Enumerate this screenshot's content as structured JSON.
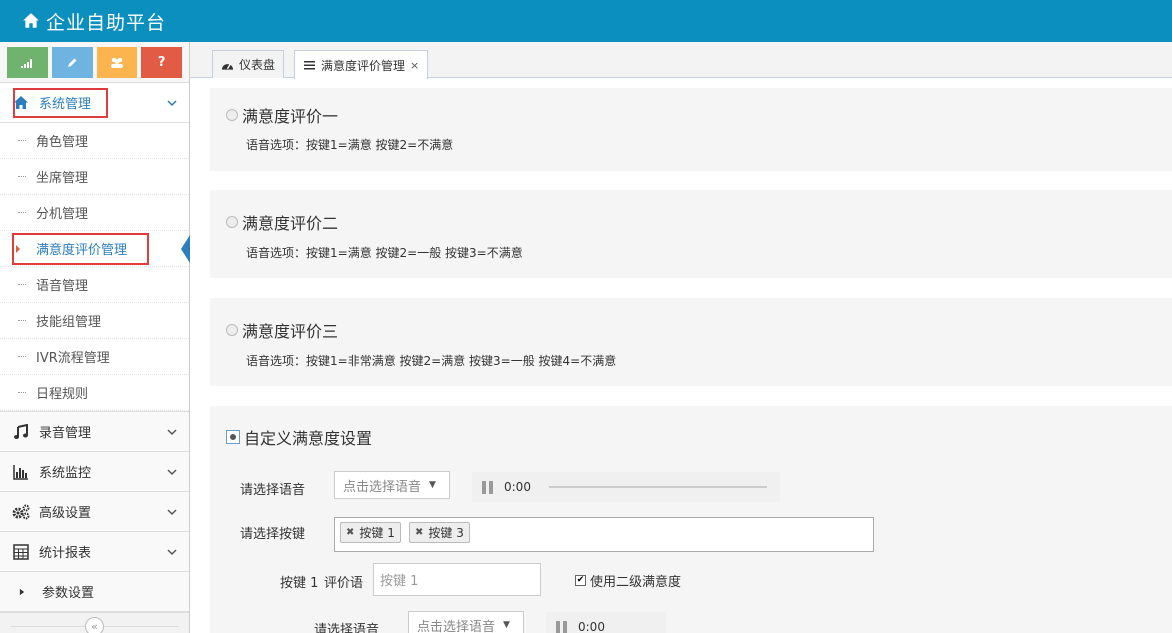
{
  "app": {
    "title": "企业自助平台"
  },
  "shortcuts": [
    {
      "icon": "signal-icon",
      "color": "#6fb36f"
    },
    {
      "icon": "pencil-icon",
      "color": "#6fb3e0"
    },
    {
      "icon": "users-icon",
      "color": "#fcb44f"
    },
    {
      "icon": "question-icon",
      "color": "#e15b45",
      "glyph": "?"
    }
  ],
  "sidebar": {
    "active_group": "系统管理",
    "sub_items": [
      "角色管理",
      "坐席管理",
      "分机管理",
      "满意度评价管理",
      "语音管理",
      "技能组管理",
      "IVR流程管理",
      "日程规则"
    ],
    "active_sub": "满意度评价管理",
    "groups": [
      {
        "label": "录音管理",
        "icon": "music-icon"
      },
      {
        "label": "系统监控",
        "icon": "bar-chart-icon"
      },
      {
        "label": "高级设置",
        "icon": "cogs-icon"
      },
      {
        "label": "统计报表",
        "icon": "calculator-icon"
      },
      {
        "label": "参数设置",
        "icon": "caret-right-icon"
      }
    ],
    "collapse_glyph": "«"
  },
  "tabs": [
    {
      "label": "仪表盘",
      "icon": "dashboard-icon"
    },
    {
      "label": "满意度评价管理",
      "icon": "list-icon",
      "close": "×"
    }
  ],
  "options": [
    {
      "title": "满意度评价一",
      "voice": "语音选项：按键1=满意 按键2=不满意"
    },
    {
      "title": "满意度评价二",
      "voice": "语音选项：按键1=满意 按键2=一般 按键3=不满意"
    },
    {
      "title": "满意度评价三",
      "voice": "语音选项：按键1=非常满意 按键2=满意 按键3=一般 按键4=不满意"
    }
  ],
  "custom": {
    "title": "自定义满意度设置",
    "select_voice_label": "请选择语音",
    "select_voice_placeholder": "点击选择语音",
    "player_time": "0:00",
    "select_keys_label": "请选择按键",
    "tags": [
      "按键 1",
      "按键 3"
    ],
    "key1_label": "按键 1",
    "eval_label": "评价语",
    "key1_placeholder": "按键 1",
    "second_level_label": "使用二级满意度",
    "select_voice_label_2": "请选择语音",
    "select_voice_placeholder_2": "点击选择语音",
    "player_time_2": "0:00"
  }
}
